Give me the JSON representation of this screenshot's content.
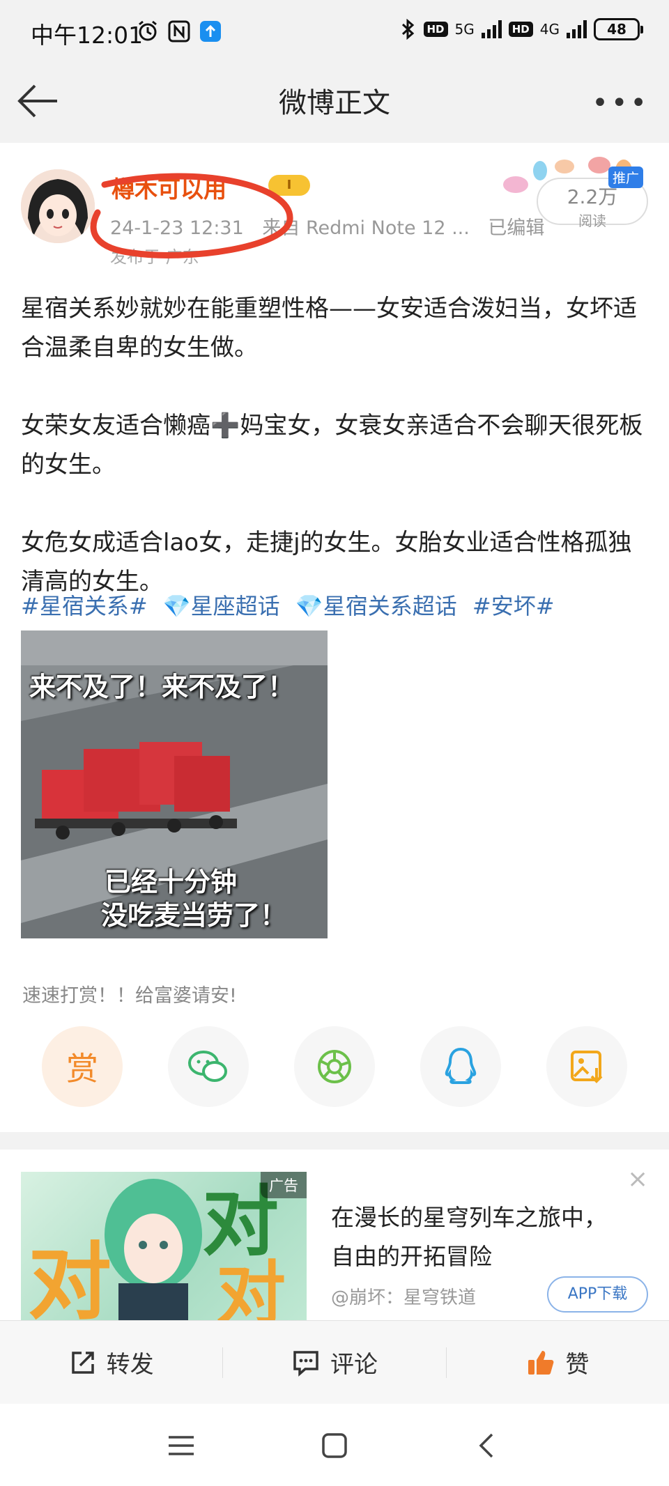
{
  "status_bar": {
    "time": "中午12:01",
    "network_5g": "5G",
    "network_4g": "4G",
    "hd_1": "HD",
    "hd_2": "HD",
    "battery": "48"
  },
  "nav": {
    "title": "微博正文",
    "more": "•••"
  },
  "post": {
    "username": "樽木可以用",
    "vip_badge": "I",
    "timestamp": "24-1-23 12:31",
    "source": "来自 Redmi Note 12 ...",
    "edited": "已编辑",
    "location": "发布于 广东",
    "read_count": "2.2万",
    "read_label": "阅读",
    "promo_tag": "推广",
    "paragraphs": [
      "星宿关系妙就妙在能重塑性格——女安适合泼妇当，女坏适合温柔自卑的女生做。",
      "女荣女友适合懒癌➕妈宝女，女衰女亲适合不会聊天很死板的女生。",
      "女危女成适合lao女，走捷j的女生。女胎女业适合性格孤独清高的女生。"
    ],
    "tags": [
      "#星宿关系#",
      "💎星座超话",
      "💎星宿关系超话",
      "#安坏#"
    ],
    "image_caption_top": "来不及了！来不及了！",
    "image_caption_bottom_1": "已经十分钟",
    "image_caption_bottom_2": "没吃麦当劳了！",
    "reward_text": "速速打赏！！给富婆请安!",
    "reward_char": "赏",
    "share_icons": [
      "reward-icon",
      "wechat-icon",
      "moments-icon",
      "qq-icon",
      "save-image-icon"
    ]
  },
  "ad": {
    "label": "广告",
    "title": "在漫长的星穹列车之旅中，自由的开拓冒险",
    "source": "@崩坏：星穹铁道",
    "button": "APP下载",
    "close": "×"
  },
  "actions": {
    "repost": "转发",
    "comment": "评论",
    "like": "赞"
  },
  "colors": {
    "username": "#e8500e",
    "link": "#3a6fb0",
    "accent_orange": "#f28a2a",
    "annotation_red": "#e8412c"
  }
}
